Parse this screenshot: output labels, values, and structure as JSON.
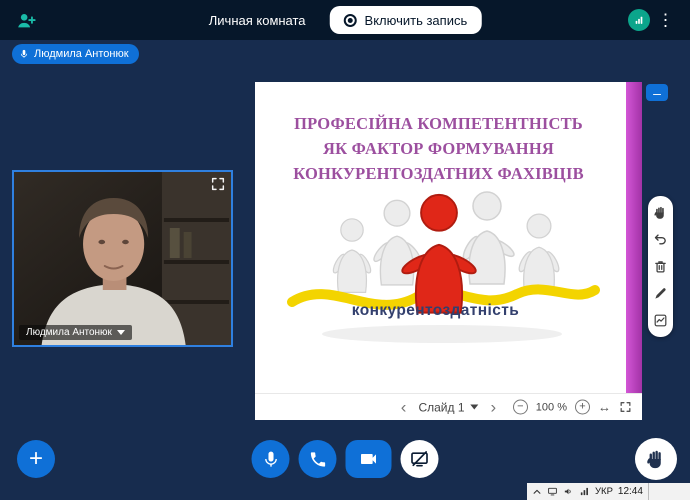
{
  "topbar": {
    "room_title": "Личная комната",
    "record_button_label": "Включить запись"
  },
  "speaker_badge": {
    "name": "Людмила Антонюк"
  },
  "webcam": {
    "name_label": "Людмила Антонюк"
  },
  "presentation": {
    "slide_title_lines": [
      "ПРОФЕСІЙНА КОМПЕТЕНТНІСТЬ",
      "ЯК ФАКТОР ФОРМУВАННЯ",
      "КОНКУРЕНТОЗДАТНИХ ФАХІВЦІВ"
    ],
    "caption": "конкурентоздатність",
    "controls": {
      "slide_label": "Слайд 1",
      "zoom_level": "100 %"
    }
  },
  "taskbar": {
    "language": "УКР",
    "time": "12:44"
  },
  "glyphs": {
    "prev": "‹",
    "next": "›",
    "menu_dots": "⋮",
    "window_minimize": "–",
    "add_button": "+",
    "zoom_out": "−",
    "zoom_in": "+",
    "fit_width": "↔"
  },
  "colors": {
    "topbar_bg": "#06172A",
    "main_bg": "#172C4E",
    "accent_blue": "#0F70D7",
    "connection_green": "#0BA58B",
    "slide_title_purple": "#9C4F9F",
    "caption_navy": "#33406E",
    "magenta_strip": "#C04AC4",
    "figure_red": "#E02718",
    "ribbon_yellow": "#F3D400",
    "webcam_border": "#2F80E0"
  }
}
